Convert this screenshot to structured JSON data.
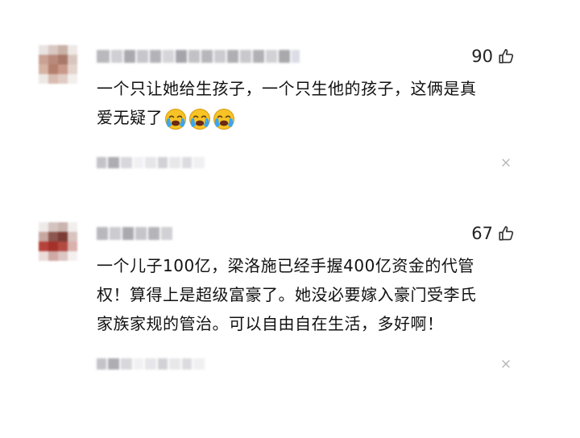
{
  "comments": [
    {
      "likes": "90",
      "text_line1": "一个只让她给生孩子，一个只生他的孩子，这俩是真",
      "text_line2": "爱无疑了",
      "emoji_icon": "crying-face-emoji"
    },
    {
      "likes": "67",
      "text_line1": "一个儿子100亿，梁洛施已经手握400亿资金的代管",
      "text_line2": "权！算得上是超级富豪了。她没必要嫁入豪门受李氏",
      "text_line3": "家族家规的管治。可以自由自在生活，多好啊！"
    }
  ],
  "icons": {
    "like": "thumbs-up-icon",
    "close": "close-icon"
  },
  "colors": {
    "text": "#111111",
    "icon": "#333333",
    "muted": "#b5b5b5"
  }
}
